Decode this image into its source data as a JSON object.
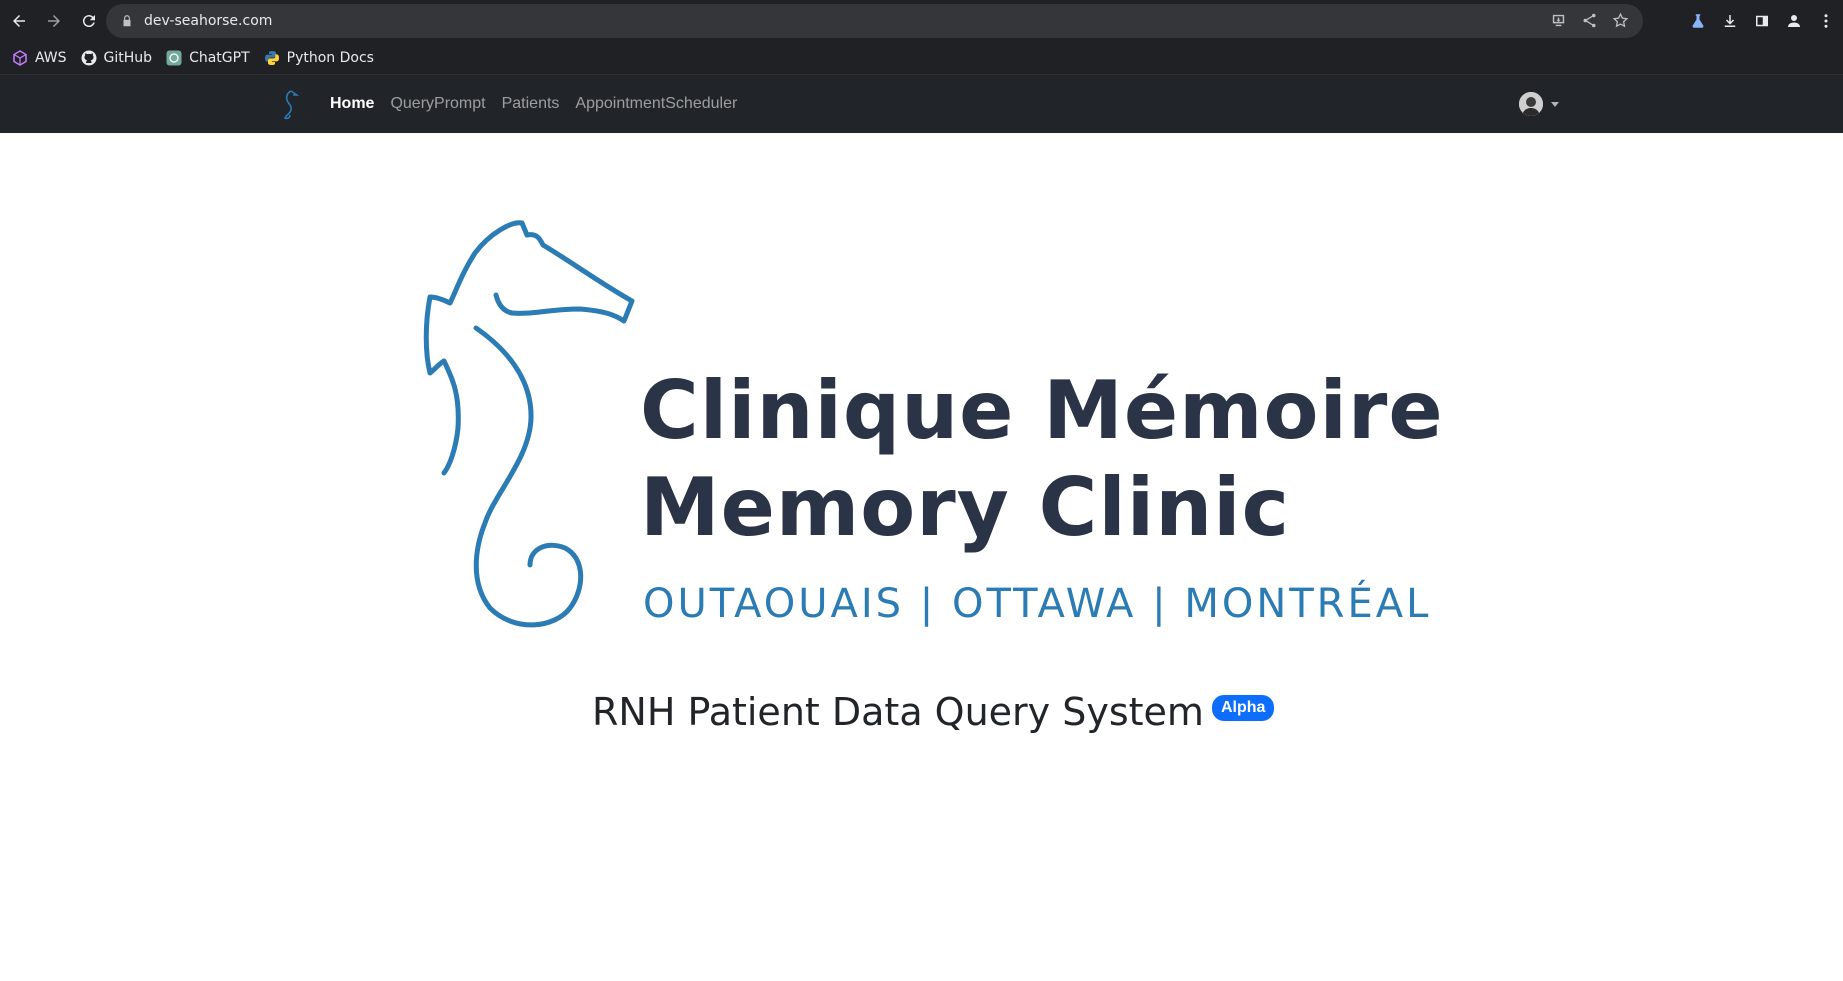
{
  "browser": {
    "url": "dev-seahorse.com",
    "bookmarks": [
      {
        "label": "AWS",
        "icon": "aws-icon"
      },
      {
        "label": "GitHub",
        "icon": "github-icon"
      },
      {
        "label": "ChatGPT",
        "icon": "chatgpt-icon"
      },
      {
        "label": "Python Docs",
        "icon": "python-icon"
      }
    ]
  },
  "navbar": {
    "links": [
      {
        "label": "Home",
        "active": true
      },
      {
        "label": "QueryPrompt",
        "active": false
      },
      {
        "label": "Patients",
        "active": false
      },
      {
        "label": "AppointmentScheduler",
        "active": false
      }
    ]
  },
  "hero": {
    "logo_line1": "Clinique Mémoire",
    "logo_line2": "Memory Clinic",
    "logo_cities": "OUTAOUAIS | OTTAWA | MONTRÉAL",
    "title": "RNH Patient Data Query System",
    "badge": "Alpha"
  },
  "colors": {
    "brand_dark": "#2b3347",
    "brand_blue": "#2b7bb4",
    "badge": "#0d6efd",
    "navbar": "#212529"
  }
}
